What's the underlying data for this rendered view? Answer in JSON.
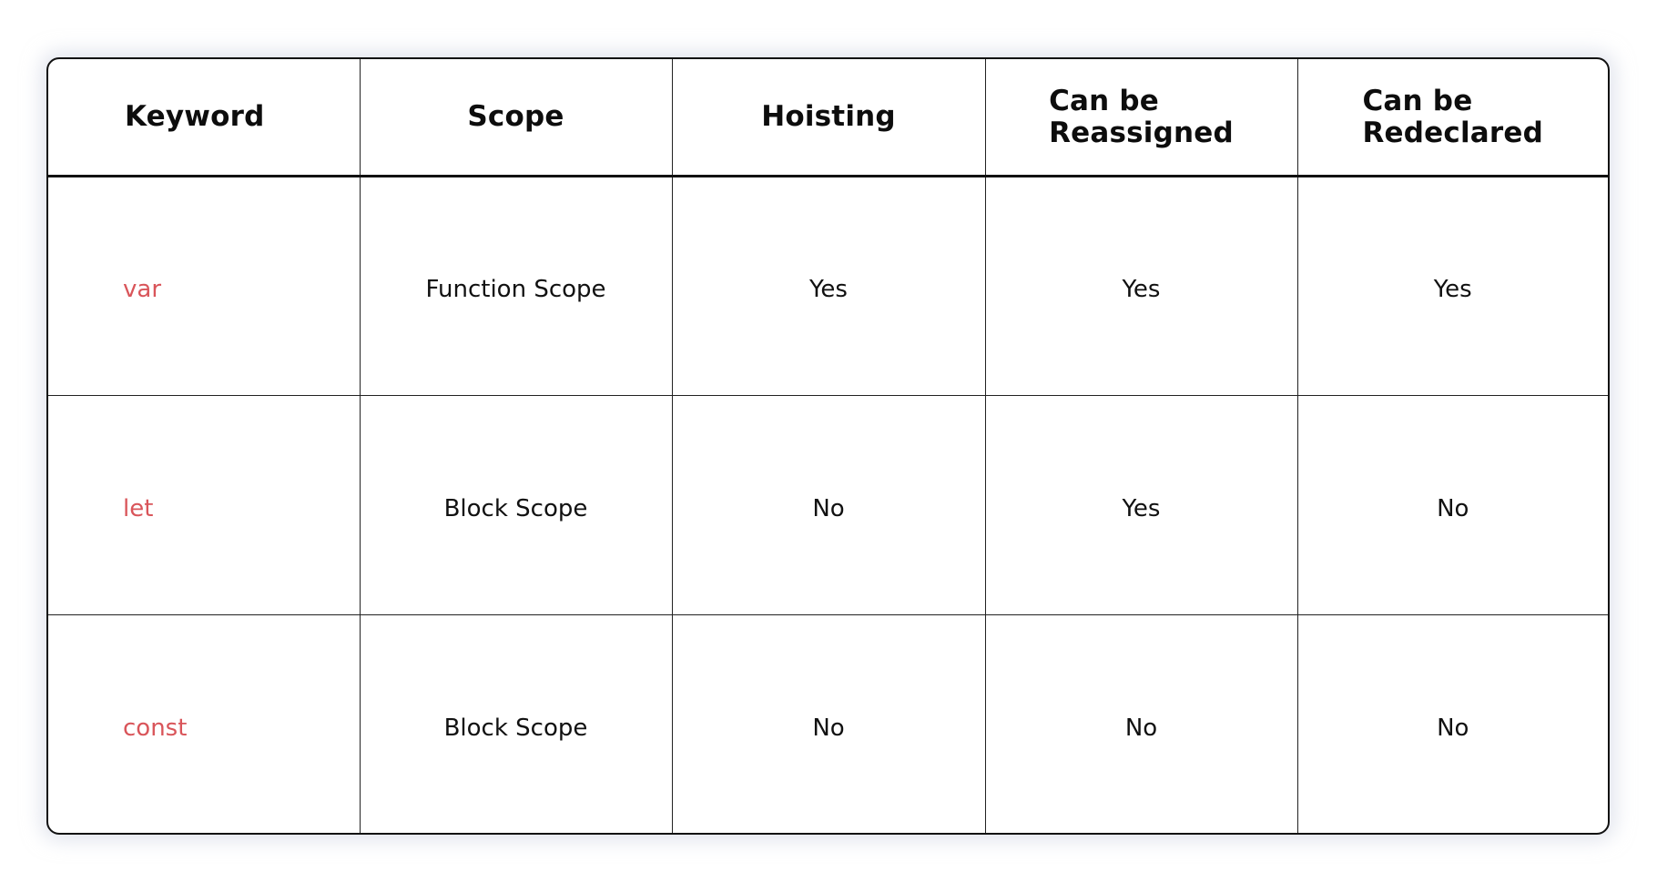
{
  "table": {
    "headers": [
      {
        "line1": "Keyword",
        "line2": ""
      },
      {
        "line1": "Scope",
        "line2": ""
      },
      {
        "line1": "Hoisting",
        "line2": ""
      },
      {
        "line1": "Can be",
        "line2": "Reassigned"
      },
      {
        "line1": "Can be",
        "line2": "Redeclared"
      }
    ],
    "rows": [
      {
        "keyword": "var",
        "scope": "Function Scope",
        "hoisting": "Yes",
        "reassigned": "Yes",
        "redeclared": "Yes"
      },
      {
        "keyword": "let",
        "scope": "Block Scope",
        "hoisting": "No",
        "reassigned": "Yes",
        "redeclared": "No"
      },
      {
        "keyword": "const",
        "scope": "Block Scope",
        "hoisting": "No",
        "reassigned": "No",
        "redeclared": "No"
      }
    ]
  },
  "colors": {
    "keyword_text": "#d9555a",
    "body_text": "#111111",
    "border": "#111111"
  }
}
